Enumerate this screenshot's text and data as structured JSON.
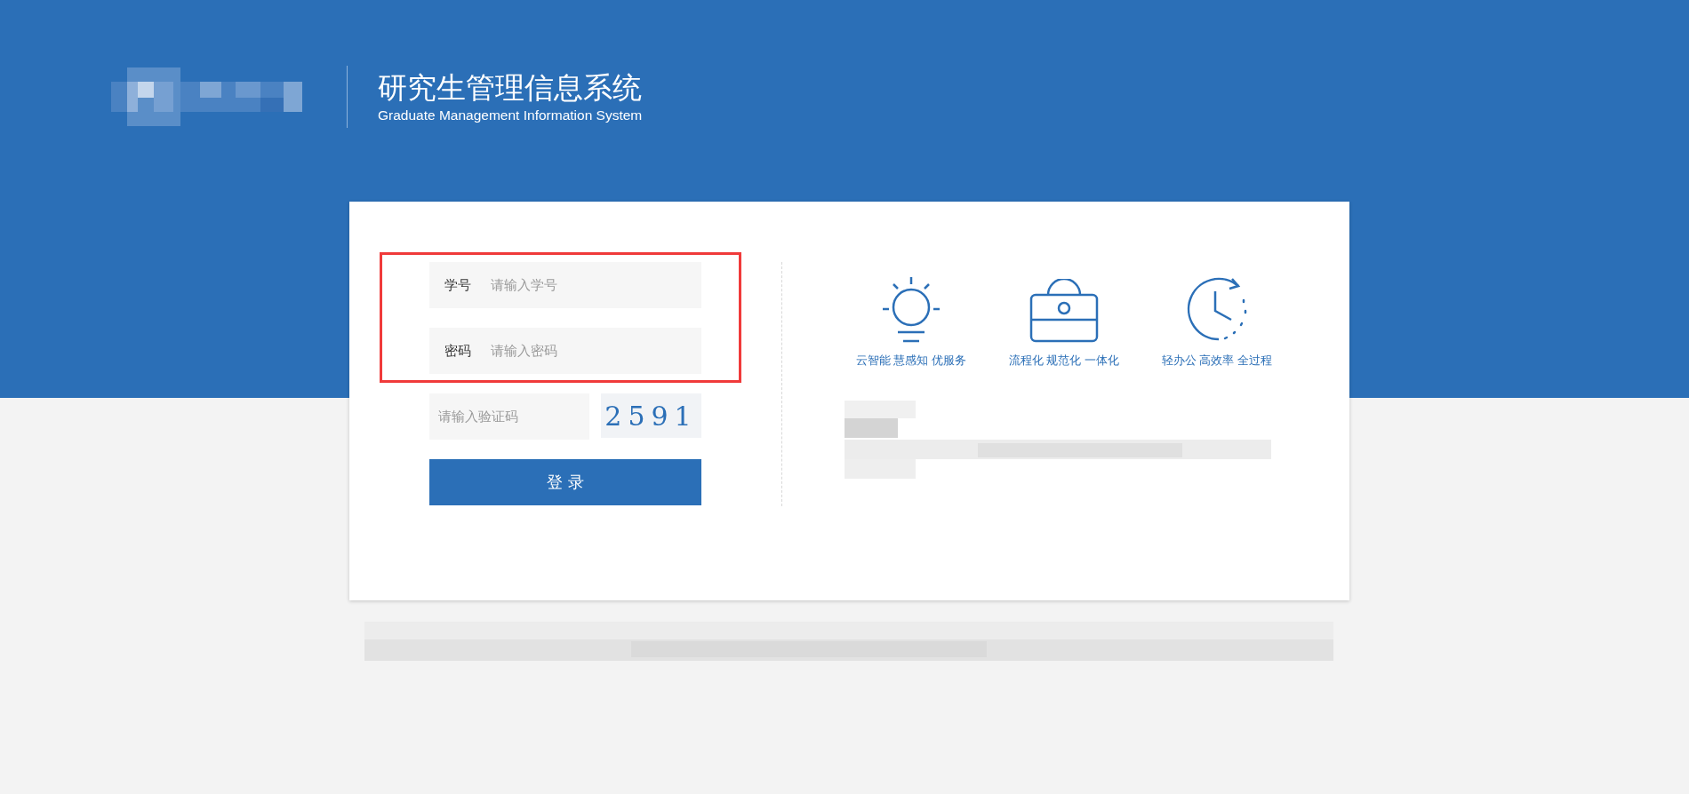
{
  "header": {
    "title": "研究生管理信息系统",
    "subtitle": "Graduate Management Information System"
  },
  "login_form": {
    "fields": [
      {
        "label": "学号",
        "placeholder": "请输入学号"
      },
      {
        "label": "密码",
        "placeholder": "请输入密码"
      }
    ],
    "captcha": {
      "placeholder": "请输入验证码",
      "code": "2591"
    },
    "submit": "登 录"
  },
  "features": [
    {
      "kind": "bulb",
      "label": "云智能 慧感知 优服务"
    },
    {
      "kind": "briefcase",
      "label": "流程化 规范化 一体化"
    },
    {
      "kind": "clock",
      "label": "轻办公 高效率 全过程"
    }
  ]
}
